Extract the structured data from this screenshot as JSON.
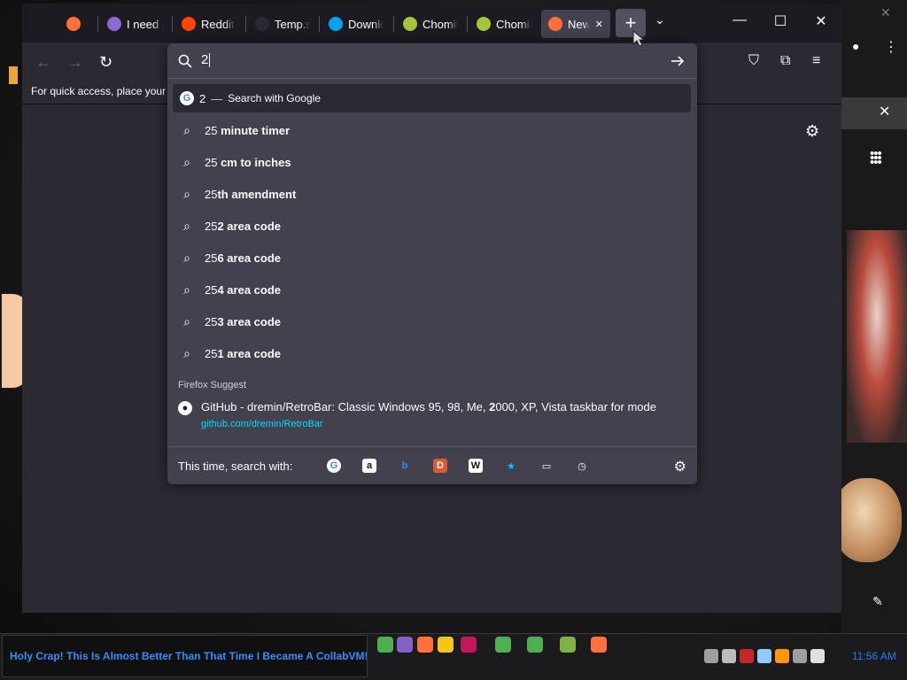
{
  "browser": {
    "tabs": [
      {
        "label": "",
        "active": false,
        "color": "#ff7139"
      },
      {
        "label": "I need m",
        "active": false,
        "color": "#8a6bd1"
      },
      {
        "label": "Reddit",
        "active": false,
        "color": "#ff4500"
      },
      {
        "label": "Temp.sh | Re",
        "active": false,
        "color": "#2b2a33"
      },
      {
        "label": "Downlo",
        "active": false,
        "color": "#00a4ef"
      },
      {
        "label": "Chomil",
        "active": false,
        "color": "#a4c639"
      },
      {
        "label": "Chomil",
        "active": false,
        "color": "#a4c639"
      },
      {
        "label": "New",
        "active": true,
        "color": "#ff7139"
      }
    ],
    "bookmarks_hint": "For quick access, place your b",
    "urlbar_query": "2"
  },
  "url_popup": {
    "heuristic": {
      "query": "2",
      "sep": "—",
      "label": "Search with Google"
    },
    "suggestions": [
      {
        "typed": "25",
        "rest": " minute timer"
      },
      {
        "typed": "25",
        "rest": " cm to inches"
      },
      {
        "typed": "25",
        "rest": "th amendment"
      },
      {
        "typed": "25",
        "rest": "2 area code"
      },
      {
        "typed": "25",
        "rest": "6 area code"
      },
      {
        "typed": "25",
        "rest": "4 area code"
      },
      {
        "typed": "25",
        "rest": "3 area code"
      },
      {
        "typed": "25",
        "rest": "1 area code"
      }
    ],
    "firefox_suggest_label": "Firefox Suggest",
    "firefox_suggest": {
      "title_pre": "GitHub - dremin/RetroBar: Classic Windows 95, 98, Me, ",
      "title_bold": "2",
      "title_post": "000, XP, Vista taskbar for mode",
      "url": "github.com/dremin/RetroBar"
    },
    "search_with_label": "This time, search with:",
    "engines": [
      {
        "name": "google-icon",
        "glyph": "G",
        "color": "#4285f4",
        "bg": "#ffffff"
      },
      {
        "name": "amazon-icon",
        "glyph": "a",
        "color": "#111111",
        "bg": "#ffffff"
      },
      {
        "name": "bing-icon",
        "glyph": "b",
        "color": "#2e8ff0",
        "bg": "transparent"
      },
      {
        "name": "duckduckgo-icon",
        "glyph": "D",
        "color": "#ffffff",
        "bg": "#de5833"
      },
      {
        "name": "wikipedia-icon",
        "glyph": "W",
        "color": "#111111",
        "bg": "#ffffff"
      },
      {
        "name": "bookmarks-icon",
        "glyph": "★",
        "color": "#00c8ff",
        "bg": "transparent"
      },
      {
        "name": "tabs-icon",
        "glyph": "▭",
        "color": "#fbfbfe",
        "bg": "transparent"
      },
      {
        "name": "history-icon",
        "glyph": "◷",
        "color": "#fbfbfe",
        "bg": "transparent"
      }
    ]
  },
  "taskbar": {
    "window_title": "Holy Crap! This Is Almost Better Than That Time I Became A CollabVM!",
    "clock": "11:56 AM",
    "apps": [
      {
        "name": "chrome-taskbar-icon",
        "color": "#4caf50"
      },
      {
        "name": "visual-studio-taskbar-icon",
        "color": "#8661c5"
      },
      {
        "name": "firefox-taskbar-icon",
        "color": "#ff7139"
      },
      {
        "name": "file-explorer-taskbar-icon",
        "color": "#f5c518"
      },
      {
        "name": "media-taskbar-icon",
        "color": "#c2185b"
      },
      {
        "name": "chrome-taskbar-icon-2",
        "color": "#4caf50"
      },
      {
        "name": "chrome-taskbar-icon-3",
        "color": "#4caf50"
      },
      {
        "name": "app-taskbar-icon",
        "color": "#7cb342"
      },
      {
        "name": "firefox-taskbar-icon-2",
        "color": "#ff7139"
      }
    ],
    "tray": [
      {
        "name": "network-icon",
        "color": "#9e9e9e"
      },
      {
        "name": "tray-app-icon-1",
        "color": "#bdbdbd"
      },
      {
        "name": "tray-app-icon-2",
        "color": "#c62828"
      },
      {
        "name": "tray-app-icon-3",
        "color": "#90caf9"
      },
      {
        "name": "tray-app-icon-4",
        "color": "#ff9800"
      },
      {
        "name": "tray-app-icon-5",
        "color": "#9e9e9e"
      },
      {
        "name": "volume-icon",
        "color": "#e0e0e0"
      }
    ]
  }
}
